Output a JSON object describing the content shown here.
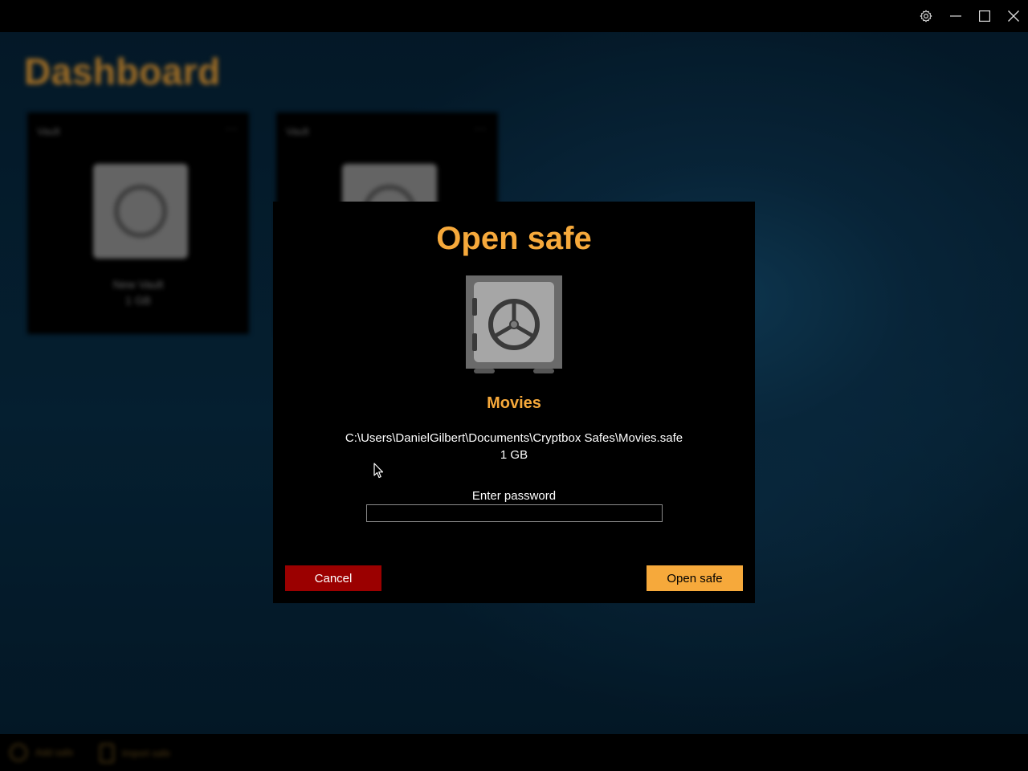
{
  "titlebar": {
    "settings_icon": "gear-icon",
    "minimize_icon": "minimize-icon",
    "maximize_icon": "maximize-icon",
    "close_icon": "close-icon"
  },
  "background": {
    "title": "Dashboard",
    "cards": [
      {
        "header": "Vault",
        "name": "New Vault",
        "size": "1 GB"
      },
      {
        "header": "Vault",
        "name": "",
        "size": ""
      }
    ],
    "bottom_bar": [
      {
        "label": "Add safe",
        "icon": "add-icon"
      },
      {
        "label": "Import safe",
        "icon": "import-icon"
      }
    ]
  },
  "dialog": {
    "title": "Open safe",
    "safe_name": "Movies",
    "path": "C:\\Users\\DanielGilbert\\Documents\\Cryptbox Safes\\Movies.safe",
    "size": "1 GB",
    "password_label": "Enter password",
    "password_value": "",
    "cancel_label": "Cancel",
    "open_label": "Open safe"
  },
  "colors": {
    "accent": "#f6a93b",
    "danger": "#9b0000",
    "dialog_bg": "#000000",
    "text": "#ffffff"
  }
}
